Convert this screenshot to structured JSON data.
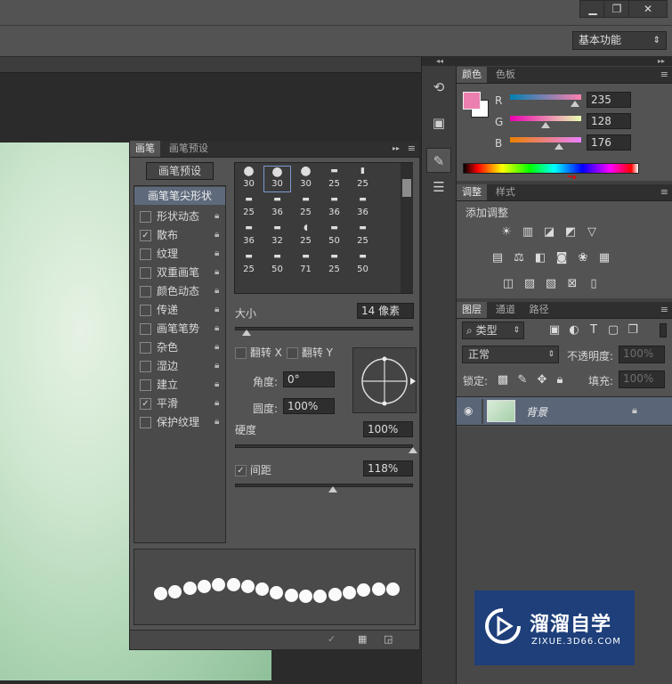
{
  "window": {
    "minimize": "▁",
    "restore": "❐",
    "close": "✕"
  },
  "options_bar": {
    "workspace": "基本功能"
  },
  "color_panel": {
    "tabs": [
      "颜色",
      "色板"
    ],
    "r_label": "R",
    "g_label": "G",
    "b_label": "B",
    "r": "235",
    "g": "128",
    "b": "176",
    "foreground": "#eb80b0",
    "background": "#ffffff"
  },
  "adjust_panel": {
    "tabs": [
      "调整",
      "样式"
    ],
    "title": "添加调整"
  },
  "layers_panel": {
    "tabs": [
      "图层",
      "通道",
      "路径"
    ],
    "filter": "类型",
    "blend_mode": "正常",
    "opacity_label": "不透明度:",
    "opacity": "100%",
    "lock_label": "锁定:",
    "fill_label": "填充:",
    "fill": "100%",
    "layer_name": "背景"
  },
  "brush_panel": {
    "tabs": [
      "画笔",
      "画笔预设"
    ],
    "preset_button": "画笔预设",
    "tip_shape": "画笔笔尖形状",
    "options": [
      {
        "label": "形状动态",
        "checked": false
      },
      {
        "label": "散布",
        "checked": true
      },
      {
        "label": "纹理",
        "checked": false
      },
      {
        "label": "双重画笔",
        "checked": false
      },
      {
        "label": "颜色动态",
        "checked": false
      },
      {
        "label": "传递",
        "checked": false
      },
      {
        "label": "画笔笔势",
        "checked": false
      },
      {
        "label": "杂色",
        "checked": false
      },
      {
        "label": "湿边",
        "checked": false
      },
      {
        "label": "建立",
        "checked": false
      },
      {
        "label": "平滑",
        "checked": true
      },
      {
        "label": "保护纹理",
        "checked": false
      }
    ],
    "tip_sizes": [
      "30",
      "30",
      "30",
      "25",
      "25",
      "25",
      "36",
      "25",
      "36",
      "36",
      "36",
      "32",
      "25",
      "50",
      "25",
      "25",
      "50",
      "71",
      "25",
      "50"
    ],
    "size_label": "大小",
    "size_value": "14 像素",
    "flip_x": "翻转 X",
    "flip_y": "翻转 Y",
    "angle_label": "角度:",
    "angle": "0°",
    "roundness_label": "圆度:",
    "roundness": "100%",
    "hardness_label": "硬度",
    "hardness": "100%",
    "spacing_label": "间距",
    "spacing": "118%",
    "spacing_checked": true
  },
  "watermark": {
    "name": "溜溜自学",
    "url": "ZIXUE.3D66.COM"
  }
}
